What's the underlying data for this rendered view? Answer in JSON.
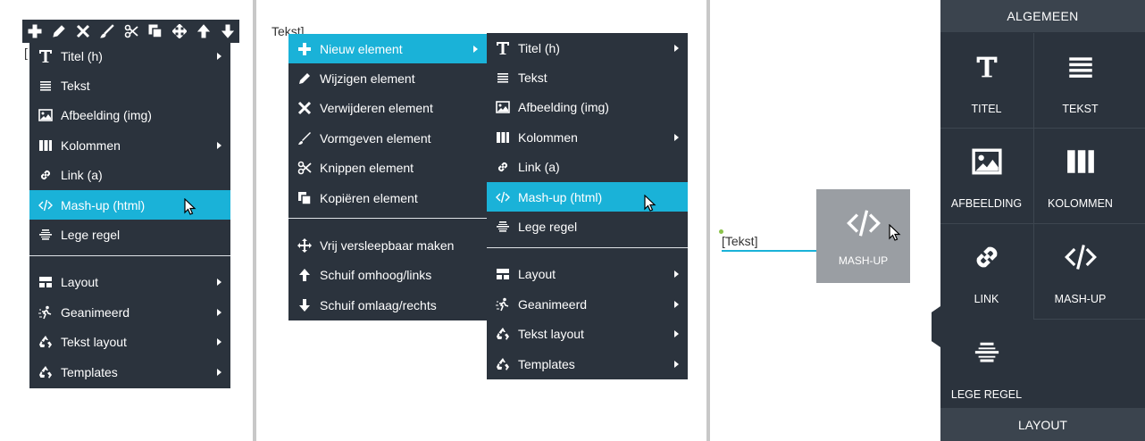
{
  "colors": {
    "menu_bg": "#2b333d",
    "accent": "#1ab2d8",
    "panel_header": "#3b444e",
    "drag_tile": "#9a9ea3"
  },
  "page_texts": {
    "fragment_1": "[",
    "fragment_2": "Tekst]",
    "inline_text": "[Tekst]"
  },
  "toolbar": {
    "icons": [
      "plus-icon",
      "pencil-icon",
      "close-icon",
      "brush-icon",
      "scissors-icon",
      "copy-icon",
      "move-icon",
      "arrow-up-icon",
      "arrow-down-icon"
    ]
  },
  "menu1": {
    "items": [
      {
        "label": "Titel (h)",
        "icon": "title-icon",
        "submenu": true
      },
      {
        "label": "Tekst",
        "icon": "text-lines-icon",
        "submenu": false
      },
      {
        "label": "Afbeelding (img)",
        "icon": "image-icon",
        "submenu": false
      },
      {
        "label": "Kolommen",
        "icon": "columns-icon",
        "submenu": true
      },
      {
        "label": "Link (a)",
        "icon": "link-icon",
        "submenu": false
      },
      {
        "label": "Mash-up (html)",
        "icon": "code-icon",
        "submenu": false,
        "active": true
      },
      {
        "label": "Lege regel",
        "icon": "empty-line-icon",
        "submenu": false
      },
      {
        "label": "Layout",
        "icon": "layout-icon",
        "submenu": true
      },
      {
        "label": "Geanimeerd",
        "icon": "animated-icon",
        "submenu": true
      },
      {
        "label": "Tekst layout",
        "icon": "recycle-icon",
        "submenu": true
      },
      {
        "label": "Templates",
        "icon": "recycle-icon",
        "submenu": true
      }
    ]
  },
  "menu2": {
    "items": [
      {
        "label": "Nieuw element",
        "icon": "plus-icon",
        "submenu": true,
        "active": true
      },
      {
        "label": "Wijzigen element",
        "icon": "pencil-icon"
      },
      {
        "label": "Verwijderen element",
        "icon": "close-icon"
      },
      {
        "label": "Vormgeven element",
        "icon": "brush-icon"
      },
      {
        "label": "Knippen element",
        "icon": "scissors-icon"
      },
      {
        "label": "Kopiëren element",
        "icon": "copy-icon"
      },
      {
        "label": "Vrij versleepbaar maken",
        "icon": "move-icon"
      },
      {
        "label": "Schuif omhoog/links",
        "icon": "arrow-up-icon"
      },
      {
        "label": "Schuif omlaag/rechts",
        "icon": "arrow-down-icon"
      }
    ]
  },
  "menu3": {
    "items": [
      {
        "label": "Titel (h)",
        "submenu": true
      },
      {
        "label": "Tekst"
      },
      {
        "label": "Afbeelding (img)"
      },
      {
        "label": "Kolommen",
        "submenu": true
      },
      {
        "label": "Link (a)"
      },
      {
        "label": "Mash-up (html)",
        "active": true
      },
      {
        "label": "Lege regel"
      },
      {
        "label": "Layout",
        "submenu": true
      },
      {
        "label": "Geanimeerd",
        "submenu": true
      },
      {
        "label": "Tekst layout",
        "submenu": true
      },
      {
        "label": "Templates",
        "submenu": true
      }
    ]
  },
  "drag_tile": {
    "label": "MASH-UP",
    "icon": "code-icon"
  },
  "panel": {
    "header": "ALGEMEEN",
    "footer": "LAYOUT",
    "tiles": [
      {
        "label": "TITEL",
        "icon": "title-icon"
      },
      {
        "label": "TEKST",
        "icon": "text-lines-icon"
      },
      {
        "label": "AFBEELDING",
        "icon": "image-icon"
      },
      {
        "label": "KOLOMMEN",
        "icon": "columns-icon"
      },
      {
        "label": "LINK",
        "icon": "link-icon"
      },
      {
        "label": "MASH-UP",
        "icon": "code-icon"
      },
      {
        "label": "LEGE REGEL",
        "icon": "empty-line-icon"
      }
    ]
  }
}
